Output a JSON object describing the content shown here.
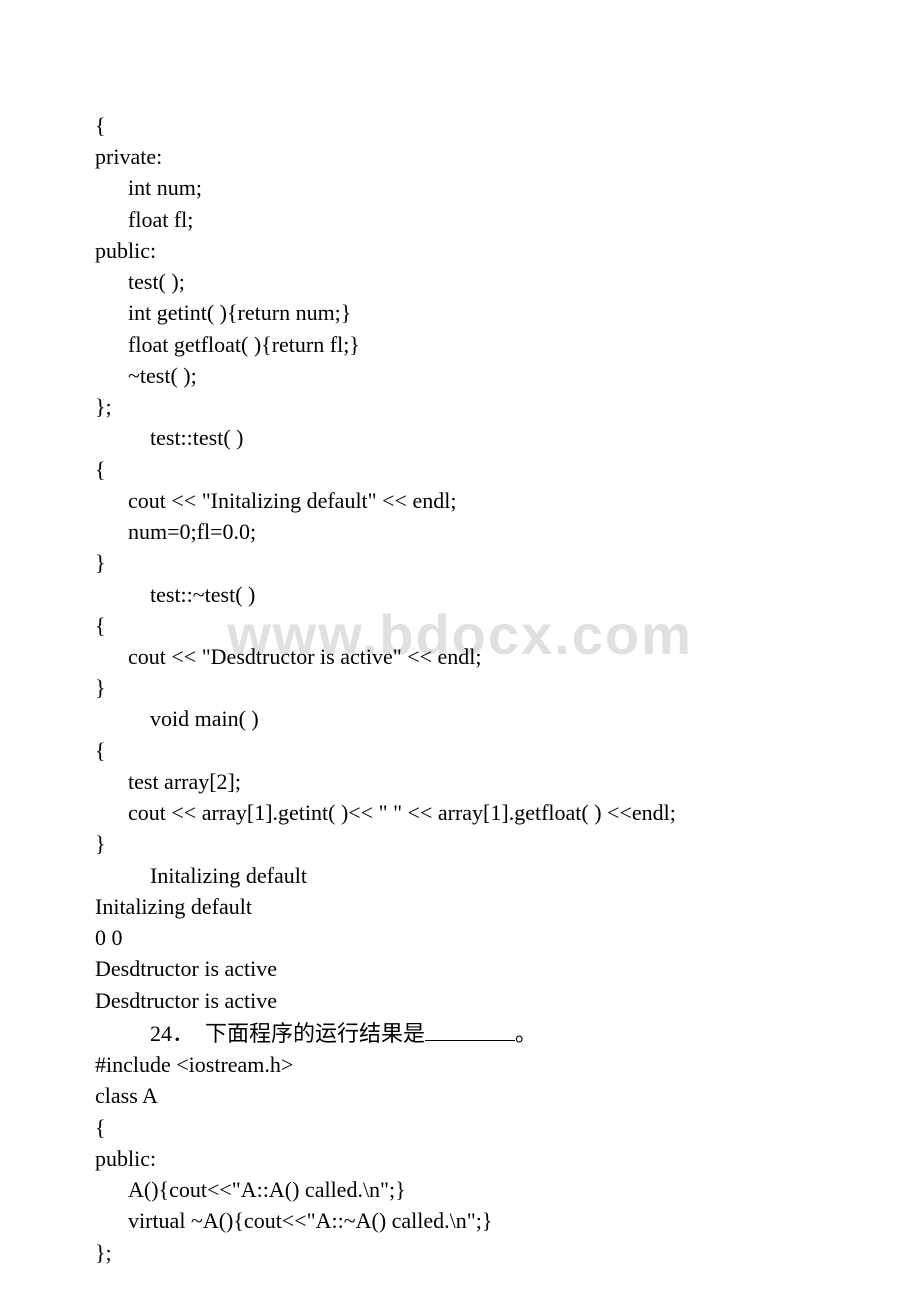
{
  "watermark": "www.bdocx.com",
  "lines": [
    {
      "cls": "line",
      "text": "{"
    },
    {
      "cls": "line",
      "text": "private:"
    },
    {
      "cls": "line indent1",
      "text": "int num;"
    },
    {
      "cls": "line indent1",
      "text": "float fl;"
    },
    {
      "cls": "line",
      "text": "public:"
    },
    {
      "cls": "line indent1",
      "text": "test( );"
    },
    {
      "cls": "line indent1",
      "text": "int getint( ){return num;}"
    },
    {
      "cls": "line indent1",
      "text": "float getfloat( ){return fl;}"
    },
    {
      "cls": "line indent1",
      "text": "~test( );"
    },
    {
      "cls": "line",
      "text": "};"
    },
    {
      "cls": "line indent-tab",
      "text": "test::test( )"
    },
    {
      "cls": "line",
      "text": "{"
    },
    {
      "cls": "line indent1",
      "text": "cout << \"Initalizing default\" << endl;"
    },
    {
      "cls": "line indent1",
      "text": "num=0;fl=0.0;"
    },
    {
      "cls": "line",
      "text": "}"
    },
    {
      "cls": "line indent-tab",
      "text": "test::~test( )"
    },
    {
      "cls": "line",
      "text": "{"
    },
    {
      "cls": "line indent1",
      "text": "cout << \"Desdtructor is active\" << endl;"
    },
    {
      "cls": "line",
      "text": "}"
    },
    {
      "cls": "line indent-tab",
      "text": "void main( )"
    },
    {
      "cls": "line",
      "text": "{"
    },
    {
      "cls": "line indent1",
      "text": "test array[2];"
    },
    {
      "cls": "line indent1",
      "text": "cout << array[1].getint( )<< \" \" << array[1].getfloat( ) <<endl;"
    },
    {
      "cls": "line",
      "text": "}"
    },
    {
      "cls": "line indent-tab",
      "text": "Initalizing default"
    },
    {
      "cls": "line",
      "text": "Initalizing default"
    },
    {
      "cls": "line",
      "text": "0 0"
    },
    {
      "cls": "line",
      "text": "Desdtructor is active"
    },
    {
      "cls": "line",
      "text": "Desdtructor is active"
    },
    {
      "cls": "q24",
      "prefix": "24．  下面程序的运行结果是",
      "suffix": "。"
    },
    {
      "cls": "line",
      "text": "#include <iostream.h>"
    },
    {
      "cls": "line",
      "text": "class A"
    },
    {
      "cls": "line",
      "text": "{"
    },
    {
      "cls": "line",
      "text": "public:"
    },
    {
      "cls": "line indent1",
      "text": "A(){cout<<\"A::A() called.\\n\";}"
    },
    {
      "cls": "line indent1",
      "text": "virtual ~A(){cout<<\"A::~A() called.\\n\";}"
    },
    {
      "cls": "line",
      "text": "};"
    }
  ]
}
